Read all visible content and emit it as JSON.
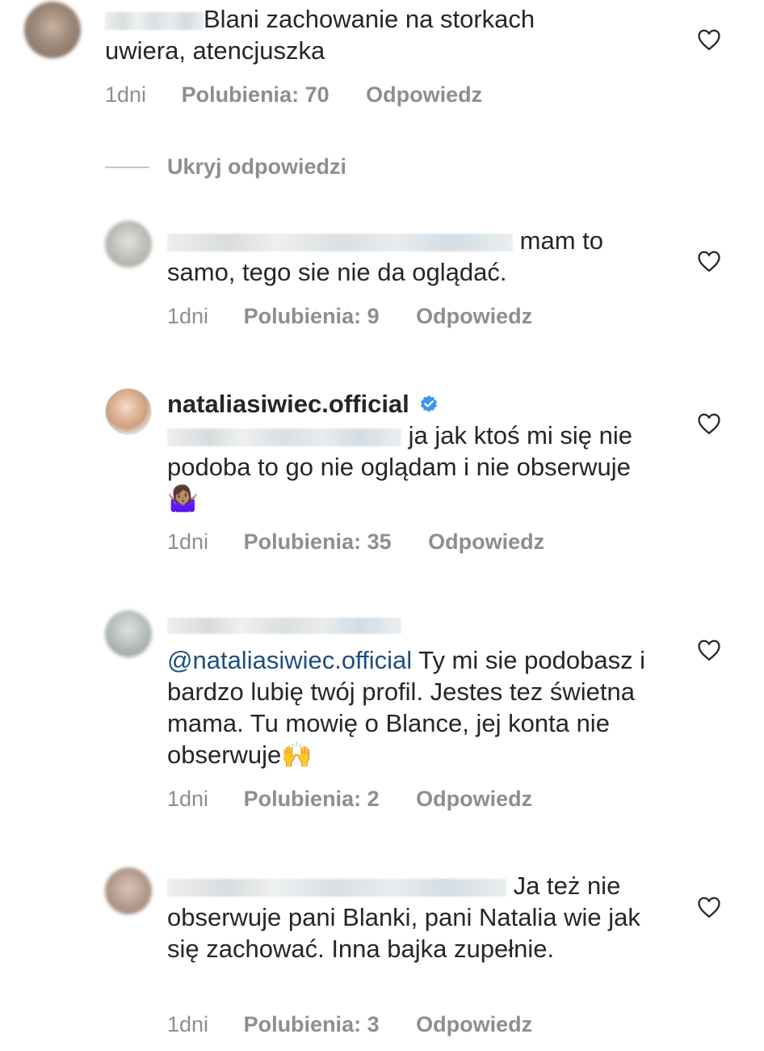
{
  "comments": [
    {
      "text": "Blani zachowanie na storkach uwiera, atencjuszka",
      "time": "1dni",
      "likes": "Polubienia: 70",
      "reply": "Odpowiedz"
    },
    {
      "text": "mam to samo, tego sie nie da oglądać.",
      "time": "1dni",
      "likes": "Polubienia: 9",
      "reply": "Odpowiedz"
    },
    {
      "username": "nataliasiwiec.official",
      "text": "ja jak ktoś mi się nie podoba to go nie oglądam i nie obserwuje 🤷🏽‍♀️",
      "time": "1dni",
      "likes": "Polubienia: 35",
      "reply": "Odpowiedz"
    },
    {
      "mention": "@nataliasiwiec.official",
      "text": "Ty mi sie podobasz i bardzo lubię twój profil. Jestes tez świetna mama. Tu mowię o Blance, jej konta nie obserwuje🙌",
      "time": "1dni",
      "likes": "Polubienia: 2",
      "reply": "Odpowiedz"
    },
    {
      "text": "Ja też nie obserwuje pani Blanki, pani Natalia wie jak się zachować. Inna bajka zupełnie.",
      "time": "1dni",
      "likes": "Polubienia: 3",
      "reply": "Odpowiedz"
    }
  ],
  "hide_replies": "Ukryj odpowiedzi",
  "icons": {
    "heart": "heart-outline-icon",
    "verified": "verified-badge-icon"
  },
  "colors": {
    "text": "#262626",
    "meta": "#8e8e8e",
    "mention": "#1f4f7f",
    "verified": "#3897f0"
  }
}
